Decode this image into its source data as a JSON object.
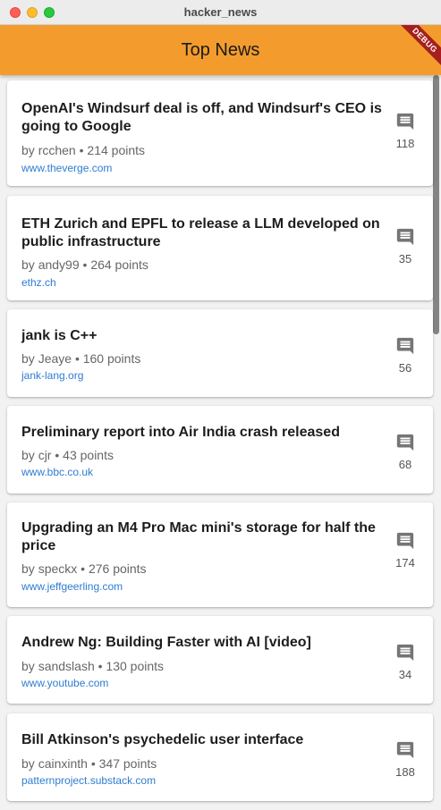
{
  "window": {
    "title": "hacker_news"
  },
  "appbar": {
    "title": "Top News",
    "debug_label": "DEBUG"
  },
  "stories": [
    {
      "title": "OpenAI's Windsurf deal is off, and Windsurf's CEO is going to Google",
      "author": "rcchen",
      "points": "214 points",
      "domain": "www.theverge.com",
      "comments": "118"
    },
    {
      "title": "ETH Zurich and EPFL to release a LLM developed on public infrastructure",
      "author": "andy99",
      "points": "264 points",
      "domain": "ethz.ch",
      "comments": "35"
    },
    {
      "title": "jank is C++",
      "author": "Jeaye",
      "points": "160 points",
      "domain": "jank-lang.org",
      "comments": "56"
    },
    {
      "title": "Preliminary report into Air India crash released",
      "author": "cjr",
      "points": "43 points",
      "domain": "www.bbc.co.uk",
      "comments": "68"
    },
    {
      "title": "Upgrading an M4 Pro Mac mini's storage for half the price",
      "author": "speckx",
      "points": "276 points",
      "domain": "www.jeffgeerling.com",
      "comments": "174"
    },
    {
      "title": "Andrew Ng: Building Faster with AI [video]",
      "author": "sandslash",
      "points": "130 points",
      "domain": "www.youtube.com",
      "comments": "34"
    },
    {
      "title": "Bill Atkinson's psychedelic user interface",
      "author": "cainxinth",
      "points": "347 points",
      "domain": "patternproject.substack.com",
      "comments": "188"
    }
  ],
  "labels": {
    "by": "by",
    "separator": "•"
  },
  "icons": {
    "comments": "comment-icon"
  },
  "colors": {
    "appbar": "#f39c2d",
    "link": "#2f7cd0",
    "debug": "#a51f1f"
  }
}
